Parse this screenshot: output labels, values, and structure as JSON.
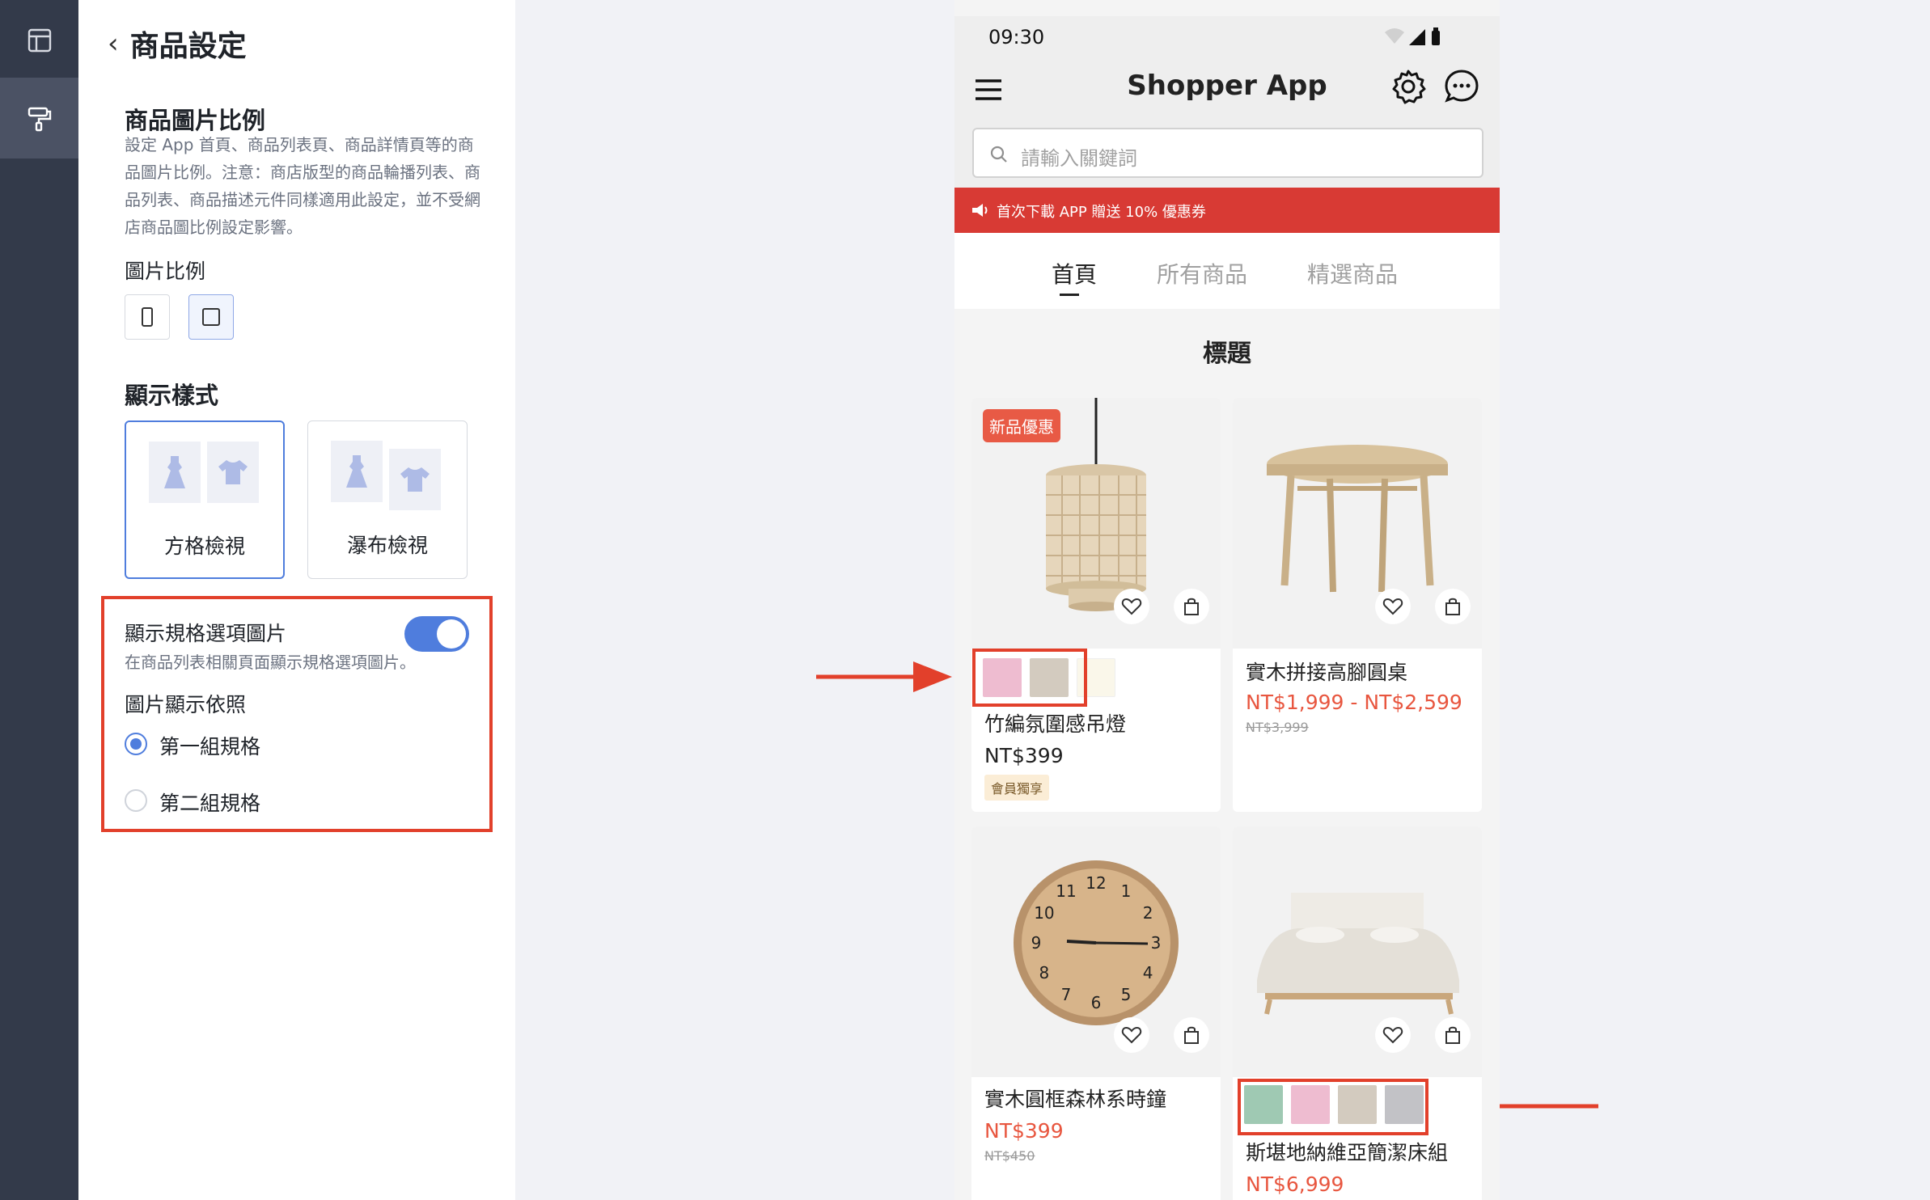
{
  "sidebar_rail": {
    "items": [
      {
        "icon": "layout-icon",
        "active": false
      },
      {
        "icon": "paint-roller-icon",
        "active": true
      }
    ]
  },
  "settings": {
    "page_title": "商品設定",
    "image_ratio": {
      "title": "商品圖片比例",
      "description": "設定 App 首頁、商品列表頁、商品詳情頁等的商品圖片比例。注意：商店版型的商品輪播列表、商品列表、商品描述元件同樣適用此設定，並不受網店商品圖比例設定影響。",
      "ratio_label": "圖片比例",
      "options": [
        {
          "icon": "portrait-ratio-icon",
          "selected": false
        },
        {
          "icon": "square-ratio-icon",
          "selected": true
        }
      ]
    },
    "display_style": {
      "title": "顯示樣式",
      "options": [
        {
          "label": "方格檢視",
          "selected": true
        },
        {
          "label": "瀑布檢視",
          "selected": false
        }
      ]
    },
    "variant_images": {
      "toggle_label": "顯示規格選項圖片",
      "toggle_on": true,
      "toggle_description": "在商品列表相關頁面顯示規格選項圖片。",
      "basis_label": "圖片顯示依照",
      "options": [
        {
          "label": "第一組規格",
          "checked": true
        },
        {
          "label": "第二組規格",
          "checked": false
        }
      ]
    }
  },
  "phone": {
    "status_time": "09:30",
    "app_title": "Shopper App",
    "search_placeholder": "請輸入關鍵詞",
    "promo_text": "首次下載 APP 贈送 10% 優惠券",
    "tabs": [
      "首頁",
      "所有商品",
      "精選商品"
    ],
    "active_tab": 0,
    "section_title": "標題",
    "products": [
      {
        "name": "竹編氛圍感吊燈",
        "price": "NT$399",
        "badge": "新品優惠",
        "member_tag": "會員獨享",
        "swatches": [
          "#eebcd0",
          "#d3cbbf",
          "#faf7ea"
        ]
      },
      {
        "name": "實木拼接高腳圓桌",
        "price": "NT$1,999 - NT$2,599",
        "original_price": "NT$3,999"
      },
      {
        "name": "實木圓框森林系時鐘",
        "price": "NT$399",
        "original_price": "NT$450"
      },
      {
        "name": "斯堪地納維亞簡潔床組",
        "price": "NT$6,999",
        "swatches": [
          "#9fc9b3",
          "#eebcd0",
          "#d3cbbf",
          "#c2c2c6"
        ]
      }
    ],
    "clock_numbers": [
      "12",
      "1",
      "2",
      "3",
      "4",
      "5",
      "6",
      "7",
      "8",
      "9",
      "10",
      "11"
    ]
  },
  "colors": {
    "accent": "#4f7ddd",
    "highlight": "#e2402b",
    "sale_price": "#e8563f",
    "promo_bg": "#d83a34",
    "rail_bg": "#333a4a"
  }
}
